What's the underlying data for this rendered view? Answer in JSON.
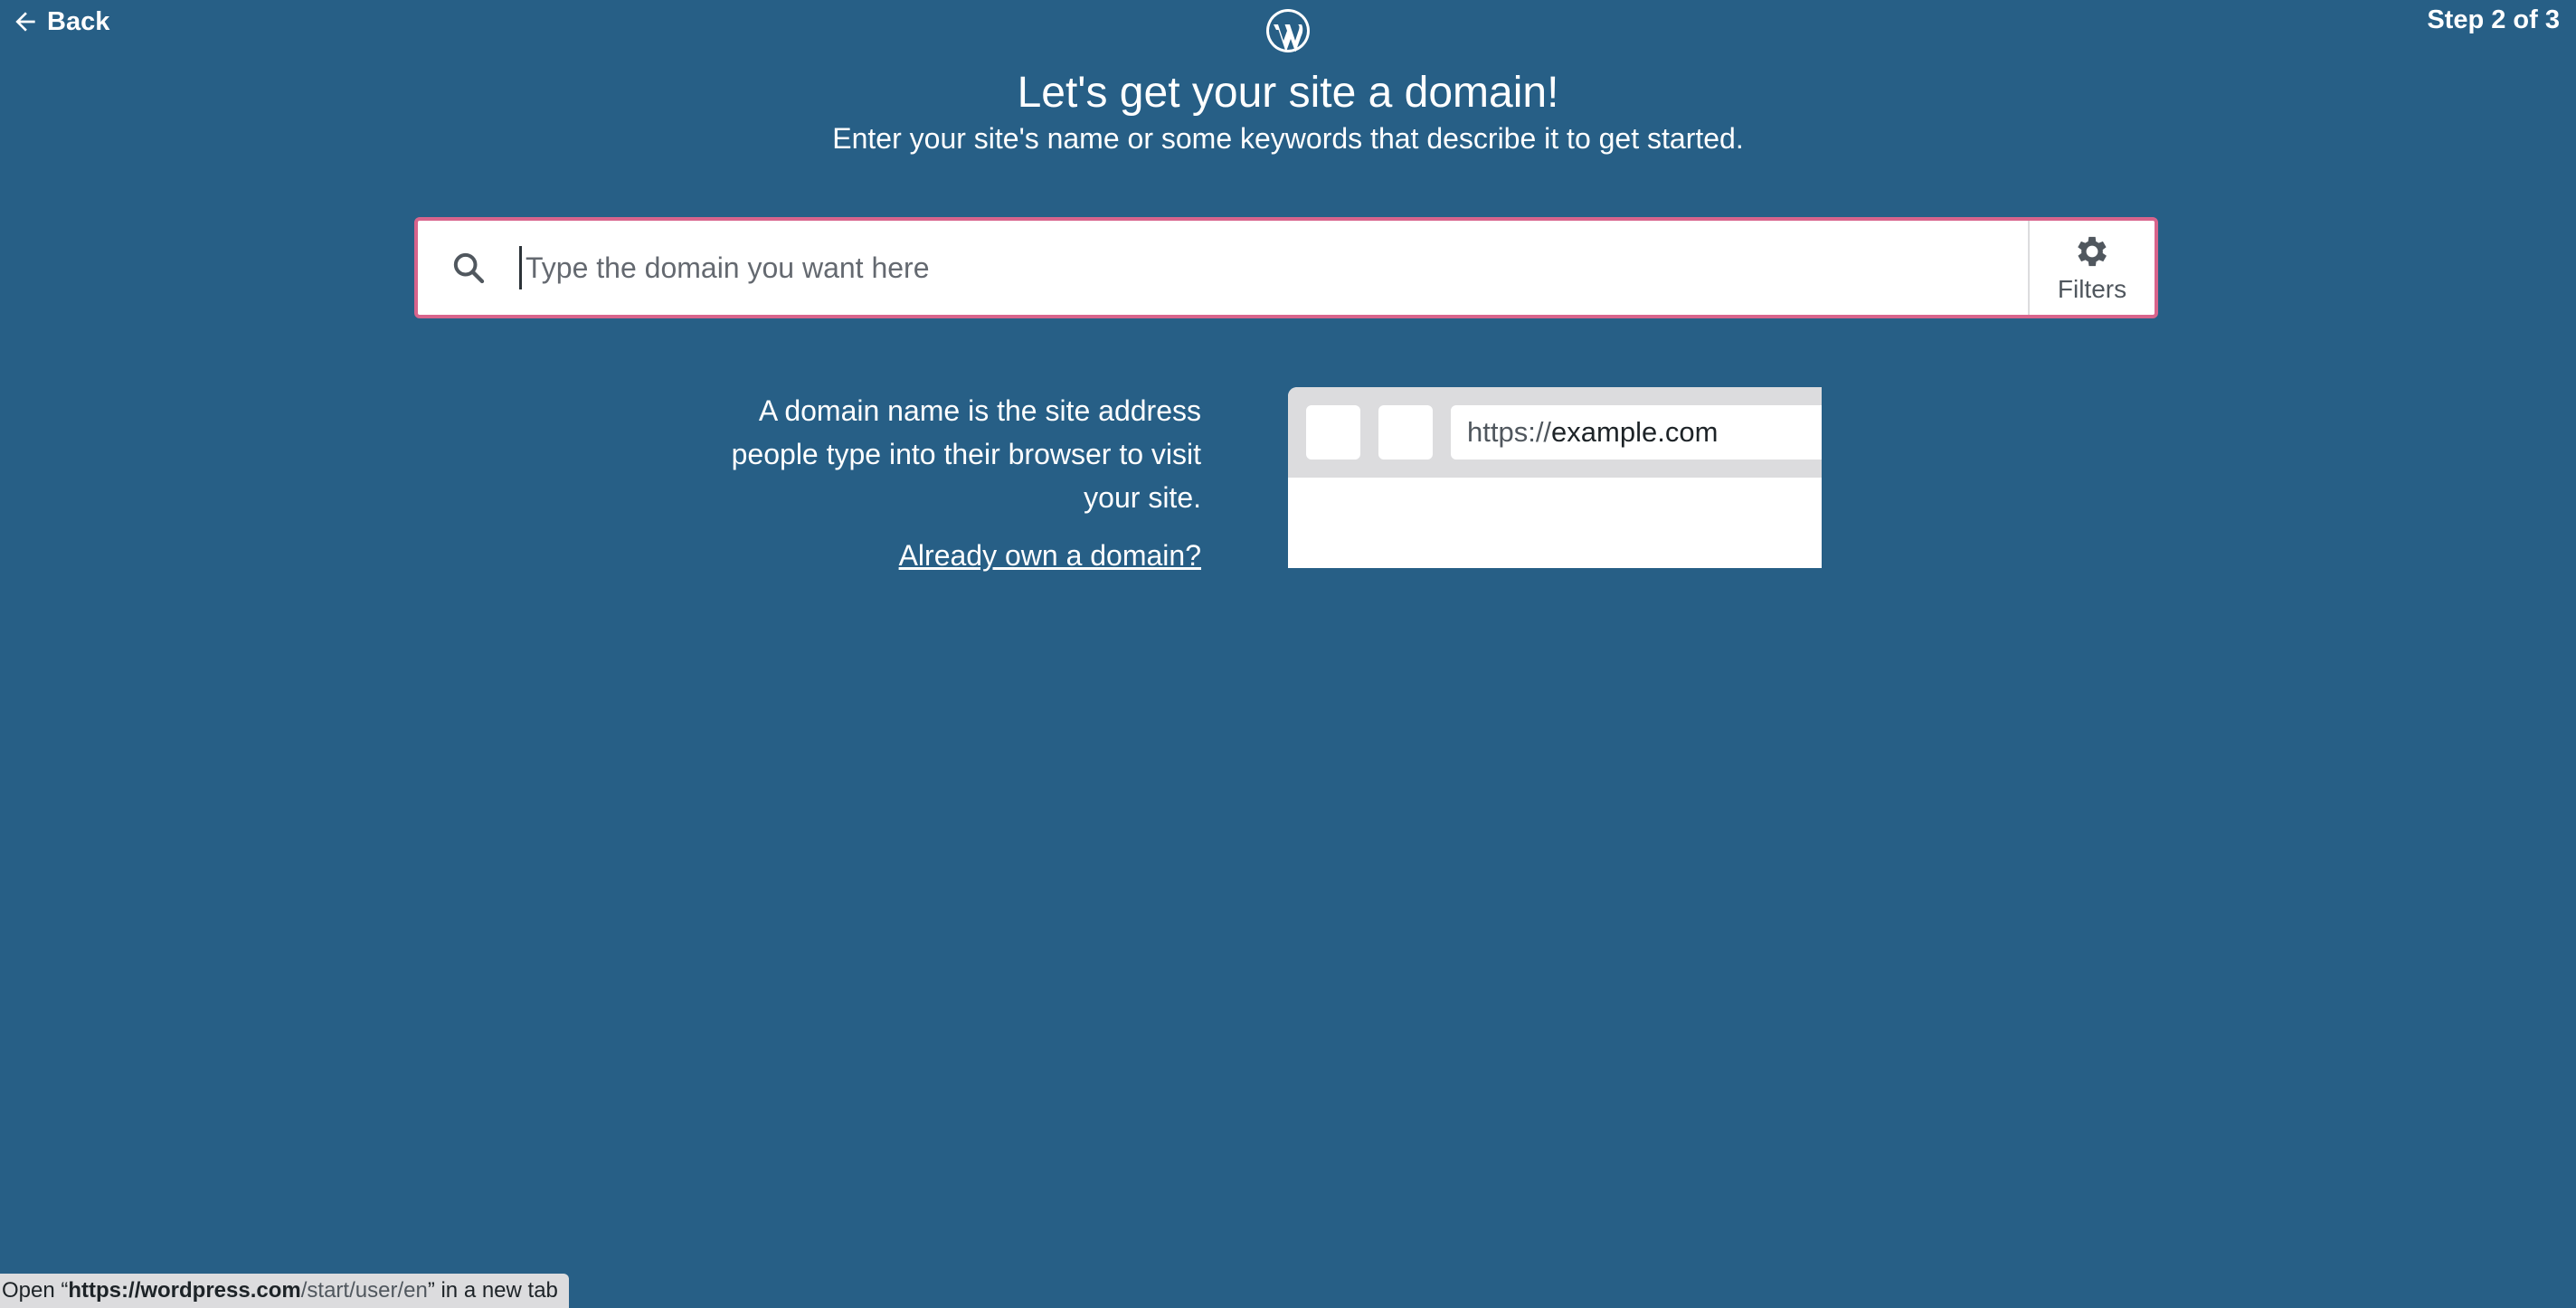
{
  "nav": {
    "back_label": "Back",
    "step_label": "Step 2 of 3"
  },
  "header": {
    "title": "Let's get your site a domain!",
    "subtitle": "Enter your site's name or some keywords that describe it to get started."
  },
  "search": {
    "placeholder": "Type the domain you want here",
    "value": "",
    "filters_label": "Filters"
  },
  "info": {
    "description": "A domain name is the site address people type into their browser to visit your site.",
    "already_own_link": "Already own a domain?"
  },
  "illustration": {
    "url_scheme": "https://",
    "url_host": "example.com"
  },
  "status_bar": {
    "prefix": "Open “",
    "url_bold": "https://wordpress.com",
    "url_rest": "/start/user/en",
    "suffix": "” in a new tab"
  },
  "colors": {
    "background": "#275f86",
    "search_border": "#d8648c"
  },
  "icons": {
    "back": "arrow-left-icon",
    "logo": "wordpress-logo-icon",
    "search": "search-icon",
    "filters": "gear-icon"
  }
}
